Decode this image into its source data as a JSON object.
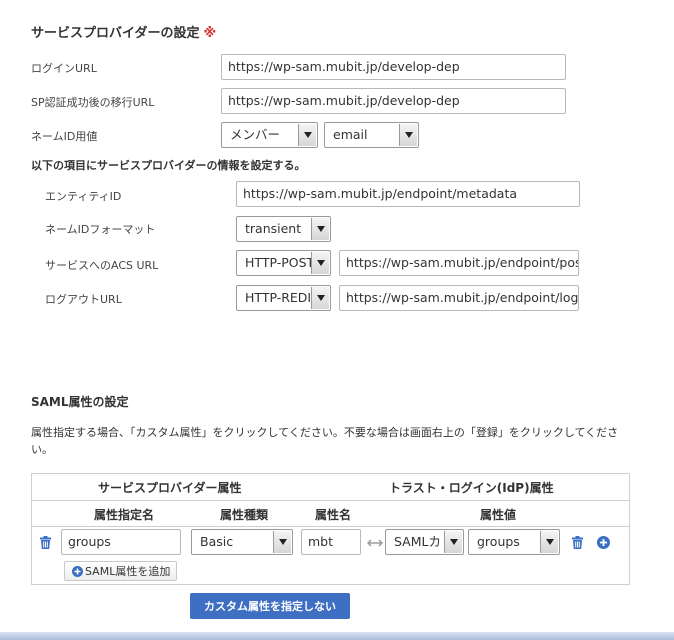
{
  "sp_settings": {
    "title": "サービスプロバイダーの設定",
    "required_mark": "※",
    "login_url": {
      "label": "ログインURL",
      "value": "https://wp-sam.mubit.jp/develop-dep"
    },
    "redirect_url": {
      "label": "SP認証成功後の移行URL",
      "value": "https://wp-sam.mubit.jp/develop-dep"
    },
    "name_id": {
      "label": "ネームID用値",
      "select1": "メンバー",
      "select2": "email"
    },
    "note": "以下の項目にサービスプロバイダーの情報を設定する。",
    "entity_id": {
      "label": "エンティティID",
      "value": "https://wp-sam.mubit.jp/endpoint/metadata"
    },
    "name_id_format": {
      "label": "ネームIDフォーマット",
      "value": "transient"
    },
    "acs_url": {
      "label": "サービスへのACS URL",
      "binding": "HTTP-POST",
      "value": "https://wp-sam.mubit.jp/endpoint/postR"
    },
    "logout_url": {
      "label": "ログアウトURL",
      "binding": "HTTP-REDI",
      "value": "https://wp-sam.mubit.jp/endpoint/logou"
    }
  },
  "saml_attrs": {
    "title": "SAML属性の設定",
    "note": "属性指定する場合、「カスタム属性」をクリックしてください。不要な場合は画面右上の「登録」をクリックしてください。",
    "table": {
      "group_sp": "サービスプロバイダー属性",
      "group_idp": "トラスト・ログイン(IdP)属性",
      "col_attr_name_spec": "属性指定名",
      "col_attr_type": "属性種類",
      "col_attr_name": "属性名",
      "col_attr_value": "属性値",
      "row": {
        "attr_name_spec": "groups",
        "attr_type": "Basic",
        "attr_name": "mbt",
        "value_source": "SAMLカ",
        "value": "groups"
      },
      "add_button": "SAML属性を追加"
    },
    "custom_button": "カスタム属性を指定しない"
  },
  "colors": {
    "accent": "#3f6fc3",
    "required": "#d0312d",
    "icon": "#3a6fc4"
  }
}
